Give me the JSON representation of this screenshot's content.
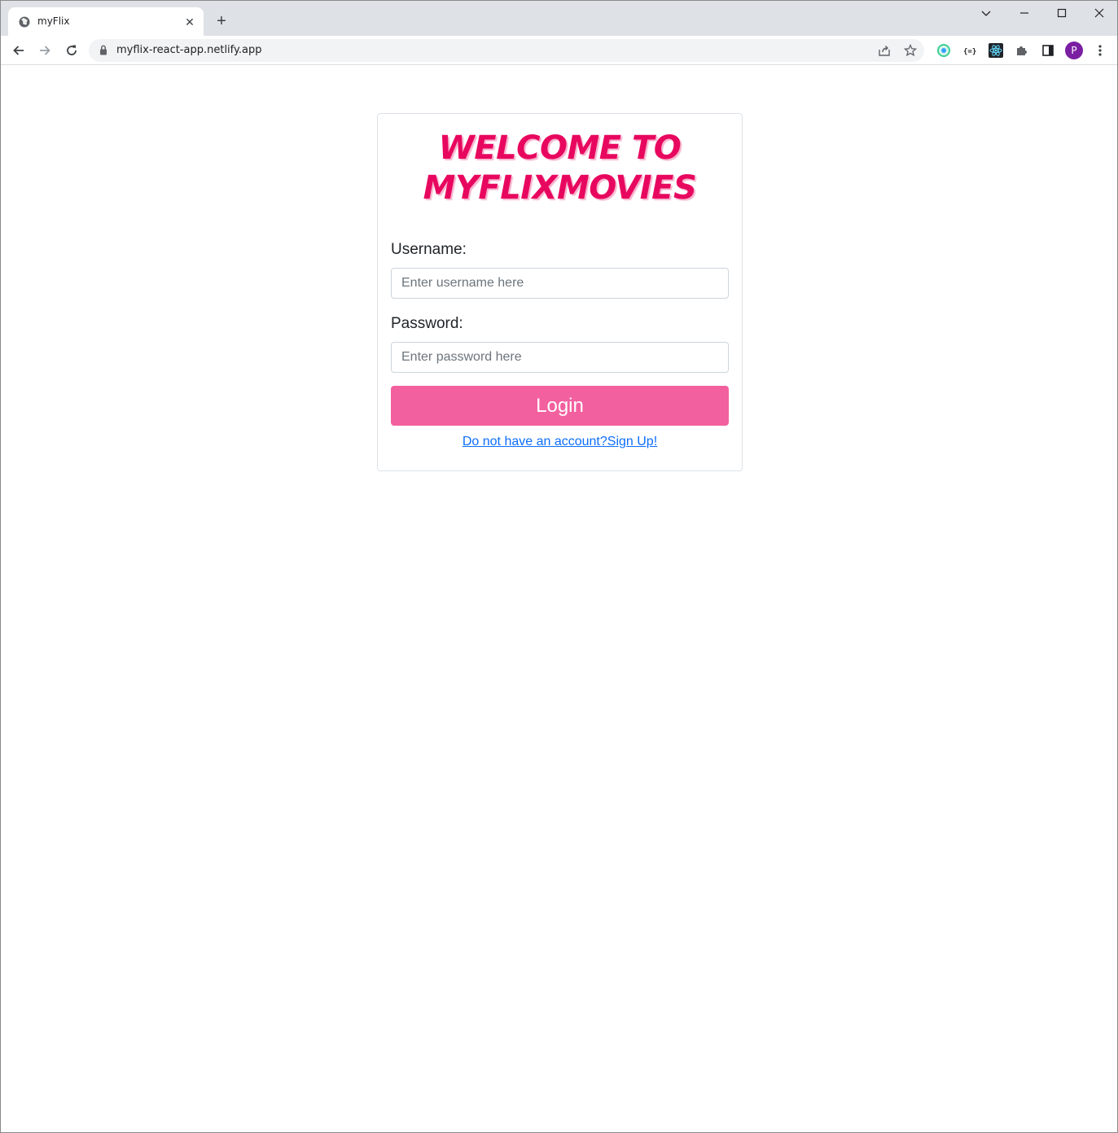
{
  "browser": {
    "tab_title": "myFlix",
    "url": "myflix-react-app.netlify.app",
    "profile_initial": "P",
    "new_tab_glyph": "+",
    "close_glyph": "✕"
  },
  "login": {
    "heading_line1": "WELCOME TO",
    "heading_line2": "MYFLIXMOVIES",
    "username_label": "Username:",
    "username_placeholder": "Enter username here",
    "password_label": "Password:",
    "password_placeholder": "Enter password here",
    "login_button": "Login",
    "signup_link": "Do not have an account?Sign Up!"
  },
  "colors": {
    "heading": "#e8075f",
    "button": "#f2609f",
    "link": "#0d6efd",
    "profile": "#7b1fa2"
  },
  "icons": [
    "globe-icon",
    "close-icon",
    "plus-icon",
    "chevron-down-icon",
    "minimize-icon",
    "maximize-icon",
    "window-close-icon",
    "back-arrow-icon",
    "forward-arrow-icon",
    "reload-icon",
    "lock-icon",
    "share-icon",
    "star-icon",
    "extension-icon",
    "json-viewer-icon",
    "react-devtools-icon",
    "puzzle-icon",
    "side-panel-icon",
    "kebab-menu-icon"
  ]
}
